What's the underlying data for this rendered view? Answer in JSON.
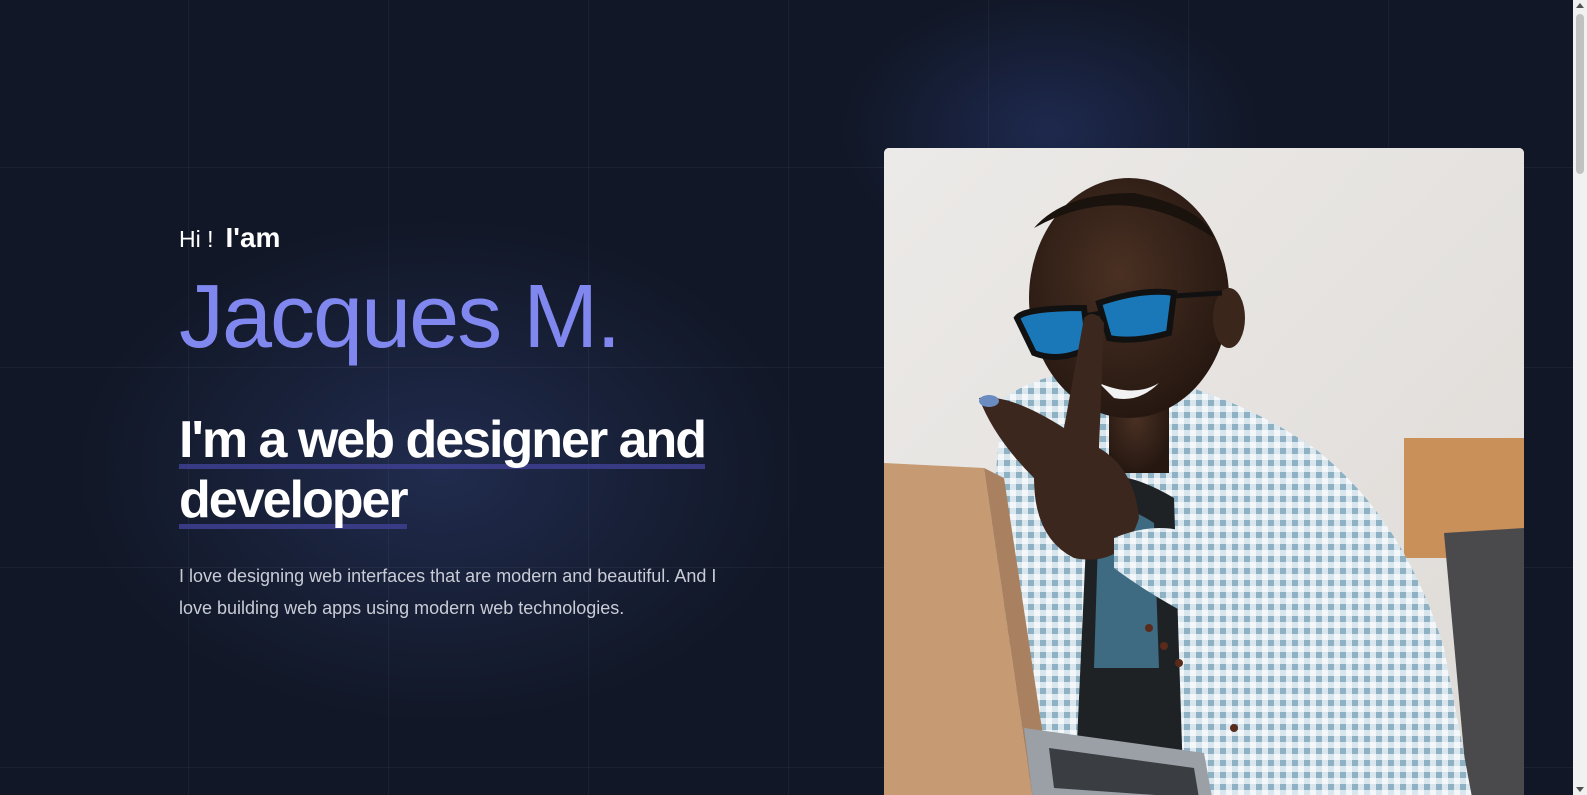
{
  "hero": {
    "greeting_hi": "Hi !",
    "greeting_iam": "I'am",
    "name": "Jacques M.",
    "headline_line1": "I'm a web designer and",
    "headline_line2": "developer",
    "bio": "I love designing web interfaces that are modern and beautiful. And I love building web apps using modern web technologies."
  },
  "colors": {
    "background": "#111726",
    "accent": "#8088f0",
    "text": "#ffffff",
    "muted": "#c9ccd6"
  },
  "photo": {
    "icon": "profile-photo"
  }
}
